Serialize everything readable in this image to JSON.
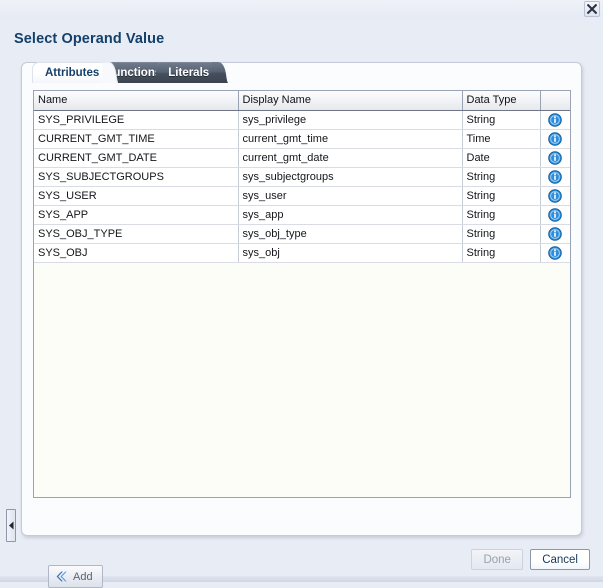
{
  "window": {
    "close_icon": "close-x-icon"
  },
  "dialog": {
    "title": "Select Operand Value"
  },
  "tabs": [
    {
      "label": "Attributes",
      "active": true
    },
    {
      "label": "Functions",
      "active": false
    },
    {
      "label": "Literals",
      "active": false
    }
  ],
  "table": {
    "columns": [
      "Name",
      "Display Name",
      "Data Type",
      ""
    ],
    "rows": [
      {
        "name": "SYS_PRIVILEGE",
        "display_name": "sys_privilege",
        "data_type": "String",
        "info_icon": "info-circle-icon"
      },
      {
        "name": "CURRENT_GMT_TIME",
        "display_name": "current_gmt_time",
        "data_type": "Time",
        "info_icon": "info-circle-icon"
      },
      {
        "name": "CURRENT_GMT_DATE",
        "display_name": "current_gmt_date",
        "data_type": "Date",
        "info_icon": "info-circle-icon"
      },
      {
        "name": "SYS_SUBJECTGROUPS",
        "display_name": "sys_subjectgroups",
        "data_type": "String",
        "info_icon": "info-circle-icon"
      },
      {
        "name": "SYS_USER",
        "display_name": "sys_user",
        "data_type": "String",
        "info_icon": "info-circle-icon"
      },
      {
        "name": "SYS_APP",
        "display_name": "sys_app",
        "data_type": "String",
        "info_icon": "info-circle-icon"
      },
      {
        "name": "SYS_OBJ_TYPE",
        "display_name": "sys_obj_type",
        "data_type": "String",
        "info_icon": "info-circle-icon"
      },
      {
        "name": "SYS_OBJ",
        "display_name": "sys_obj",
        "data_type": "String",
        "info_icon": "info-circle-icon"
      }
    ]
  },
  "toolbar": {
    "add_label": "Add",
    "add_icon": "double-chevron-left-icon"
  },
  "splitter": {
    "icon": "collapse-left-arrow-icon"
  },
  "footer": {
    "done_label": "Done",
    "done_enabled": false,
    "cancel_label": "Cancel"
  },
  "colors": {
    "title_blue": "#14406b",
    "tab_active_text": "#14406b",
    "tab_inactive_bg": "#55606f",
    "info_icon_blue": "#1f7fd0",
    "panel_bg": "#fbfcfe",
    "page_bg": "#e8ecf5"
  }
}
